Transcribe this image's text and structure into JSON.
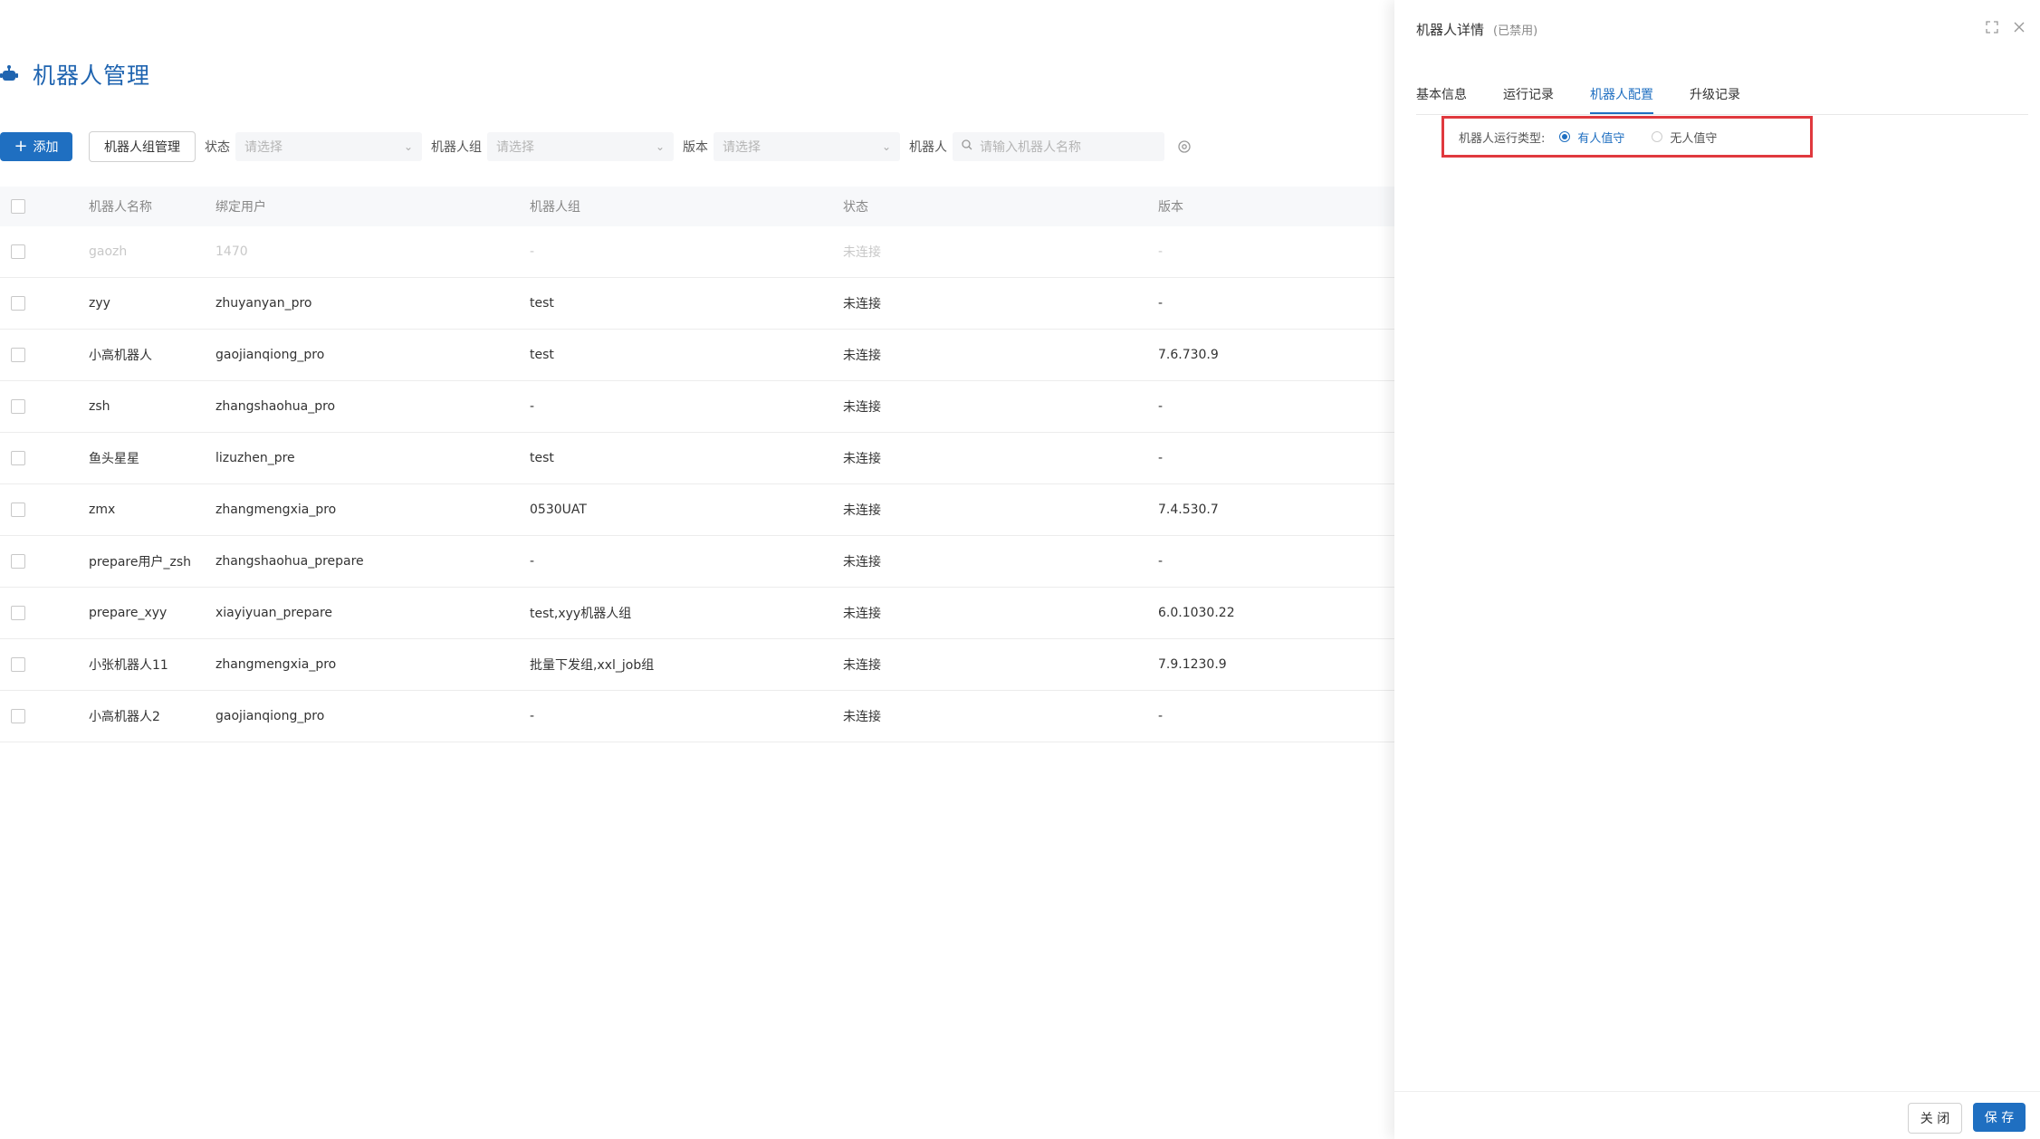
{
  "page": {
    "title": "机器人管理"
  },
  "toolbar": {
    "add_label": "添加",
    "group_manage_label": "机器人组管理",
    "status_label": "状态",
    "status_placeholder": "请选择",
    "group_label": "机器人组",
    "group_placeholder": "请选择",
    "version_label": "版本",
    "version_placeholder": "请选择",
    "robot_label": "机器人",
    "robot_placeholder": "请输入机器人名称"
  },
  "table": {
    "headers": [
      "机器人名称",
      "绑定用户",
      "机器人组",
      "状态",
      "版本"
    ],
    "rows": [
      {
        "name": "gaozh",
        "user": "1470",
        "group": "-",
        "status": "未连接",
        "version": "-",
        "disabled": true
      },
      {
        "name": "zyy",
        "user": "zhuyanyan_pro",
        "group": "test",
        "status": "未连接",
        "version": "-"
      },
      {
        "name": "小高机器人",
        "user": "gaojianqiong_pro",
        "group": "test",
        "status": "未连接",
        "version": "7.6.730.9"
      },
      {
        "name": "zsh",
        "user": "zhangshaohua_pro",
        "group": "-",
        "status": "未连接",
        "version": "-"
      },
      {
        "name": "鱼头星星",
        "user": "lizuzhen_pre",
        "group": "test",
        "status": "未连接",
        "version": "-"
      },
      {
        "name": "zmx",
        "user": "zhangmengxia_pro",
        "group": "0530UAT",
        "status": "未连接",
        "version": "7.4.530.7"
      },
      {
        "name": "prepare用户_zsh",
        "user": "zhangshaohua_prepare",
        "group": "-",
        "status": "未连接",
        "version": "-"
      },
      {
        "name": "prepare_xyy",
        "user": "xiayiyuan_prepare",
        "group": "test,xyy机器人组",
        "status": "未连接",
        "version": "6.0.1030.22"
      },
      {
        "name": "小张机器人11",
        "user": "zhangmengxia_pro",
        "group": "批量下发组,xxl_job组",
        "status": "未连接",
        "version": "7.9.1230.9"
      },
      {
        "name": "小高机器人2",
        "user": "gaojianqiong_pro",
        "group": "-",
        "status": "未连接",
        "version": "-"
      }
    ]
  },
  "drawer": {
    "title": "机器人详情",
    "subtitle": "(已禁用)",
    "tabs": [
      {
        "label": "基本信息",
        "active": false
      },
      {
        "label": "运行记录",
        "active": false
      },
      {
        "label": "机器人配置",
        "active": true
      },
      {
        "label": "升级记录",
        "active": false
      }
    ],
    "config": {
      "label": "机器人运行类型:",
      "options": [
        {
          "label": "有人值守",
          "checked": true
        },
        {
          "label": "无人值守",
          "checked": false
        }
      ]
    },
    "close_label": "关 闭",
    "save_label": "保 存"
  },
  "colors": {
    "primary": "#1f6fc1",
    "title": "#1f64b0",
    "highlight_border": "#e0393e"
  },
  "icons": [
    "robot-icon",
    "plus-icon",
    "chevron-down-icon",
    "search-icon",
    "settings-icon",
    "fullscreen-icon",
    "close-icon"
  ]
}
